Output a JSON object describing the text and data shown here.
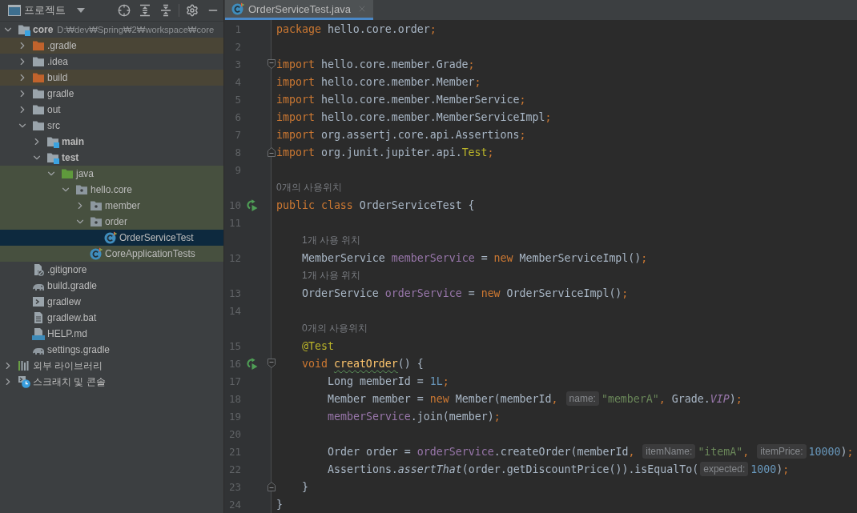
{
  "sidebar": {
    "title": "프로젝트",
    "tree": [
      {
        "label": "core",
        "hint": "D:₩dev₩Spring₩2₩workspace₩core",
        "kind": "module",
        "expanded": true,
        "selected": false,
        "children": [
          {
            "label": ".gradle",
            "kind": "excluded-folder",
            "color": "#4a4536",
            "expanded": false,
            "selected": false
          },
          {
            "label": ".idea",
            "kind": "folder",
            "expanded": false,
            "selected": false
          },
          {
            "label": "build",
            "kind": "excluded-folder",
            "color": "#4a4536",
            "expanded": false,
            "selected": false
          },
          {
            "label": "gradle",
            "kind": "folder",
            "expanded": false,
            "selected": false
          },
          {
            "label": "out",
            "kind": "folder",
            "expanded": false,
            "selected": false
          },
          {
            "label": "src",
            "kind": "folder",
            "expanded": true,
            "selected": false,
            "children": [
              {
                "label": "main",
                "kind": "module",
                "expanded": false,
                "selected": false
              },
              {
                "label": "test",
                "kind": "module",
                "expanded": true,
                "selected": false,
                "children": [
                  {
                    "label": "java",
                    "kind": "test-root",
                    "color": "#47503f",
                    "expanded": true,
                    "selected": false,
                    "children": [
                      {
                        "label": "hello.core",
                        "kind": "package",
                        "color": "#47503f",
                        "expanded": true,
                        "selected": false,
                        "children": [
                          {
                            "label": "member",
                            "kind": "package",
                            "color": "#47503f",
                            "expanded": false,
                            "selected": false
                          },
                          {
                            "label": "order",
                            "kind": "package",
                            "color": "#47503f",
                            "expanded": true,
                            "selected": false,
                            "children": [
                              {
                                "label": "OrderServiceTest",
                                "kind": "test-class",
                                "selected": true
                              }
                            ]
                          },
                          {
                            "label": "CoreApplicationTests",
                            "kind": "test-class",
                            "color": "#47503f",
                            "selected": false
                          }
                        ]
                      }
                    ]
                  }
                ]
              }
            ]
          },
          {
            "label": ".gitignore",
            "kind": "ignore-file",
            "selected": false
          },
          {
            "label": "build.gradle",
            "kind": "gradle-file",
            "selected": false
          },
          {
            "label": "gradlew",
            "kind": "shell-file",
            "selected": false
          },
          {
            "label": "gradlew.bat",
            "kind": "text-file",
            "selected": false
          },
          {
            "label": "HELP.md",
            "kind": "markdown-file",
            "selected": false
          },
          {
            "label": "settings.gradle",
            "kind": "gradle-file",
            "selected": false
          }
        ]
      },
      {
        "label": "외부 라이브러리",
        "kind": "libraries",
        "expanded": false,
        "selected": false
      },
      {
        "label": "스크래치 및 콘솔",
        "kind": "scratches",
        "expanded": false,
        "selected": false
      }
    ]
  },
  "editor": {
    "tabs": [
      {
        "label": "OrderServiceTest.java",
        "selected": true
      }
    ],
    "lines": [
      {
        "kind": "code",
        "number": "1",
        "tokens": [
          {
            "text": "package",
            "kind": "keyword"
          },
          {
            "text": " hello.core.order",
            "kind": "plain"
          },
          {
            "text": ";",
            "kind": "punct"
          }
        ]
      },
      {
        "kind": "code",
        "number": "2"
      },
      {
        "kind": "code",
        "number": "3",
        "markers": [
          {
            "kind": "fold-start"
          }
        ],
        "tokens": [
          {
            "text": "import",
            "kind": "keyword"
          },
          {
            "text": " hello.core.member.Grade",
            "kind": "plain"
          },
          {
            "text": ";",
            "kind": "punct"
          }
        ]
      },
      {
        "kind": "code",
        "number": "4",
        "tokens": [
          {
            "text": "import",
            "kind": "keyword"
          },
          {
            "text": " hello.core.member.Member",
            "kind": "plain"
          },
          {
            "text": ";",
            "kind": "punct"
          }
        ]
      },
      {
        "kind": "code",
        "number": "5",
        "tokens": [
          {
            "text": "import",
            "kind": "keyword"
          },
          {
            "text": " hello.core.member.MemberService",
            "kind": "plain"
          },
          {
            "text": ";",
            "kind": "punct"
          }
        ]
      },
      {
        "kind": "code",
        "number": "6",
        "tokens": [
          {
            "text": "import",
            "kind": "keyword"
          },
          {
            "text": " hello.core.member.MemberServiceImpl",
            "kind": "plain"
          },
          {
            "text": ";",
            "kind": "punct"
          }
        ]
      },
      {
        "kind": "code",
        "number": "7",
        "tokens": [
          {
            "text": "import",
            "kind": "keyword"
          },
          {
            "text": " org.assertj.core.api.Assertions",
            "kind": "plain"
          },
          {
            "text": ";",
            "kind": "punct"
          }
        ]
      },
      {
        "kind": "code",
        "number": "8",
        "markers": [
          {
            "kind": "fold-end"
          }
        ],
        "tokens": [
          {
            "text": "import",
            "kind": "keyword"
          },
          {
            "text": " org.junit.jupiter.api.",
            "kind": "plain"
          },
          {
            "text": "Test",
            "kind": "annotation"
          },
          {
            "text": ";",
            "kind": "punct"
          }
        ]
      },
      {
        "kind": "code",
        "number": "9"
      },
      {
        "kind": "usages",
        "tokens": [
          {
            "text": "0개의 사용위치",
            "kind": "usages"
          }
        ]
      },
      {
        "kind": "code",
        "number": "10",
        "markers": [
          {
            "kind": "run"
          }
        ],
        "tokens": [
          {
            "text": "public class",
            "kind": "keyword"
          },
          {
            "text": " OrderServiceTest {",
            "kind": "plain"
          }
        ],
        "children": [
          {
            "kind": "code",
            "number": "11"
          },
          {
            "kind": "usages",
            "tokens": [
              {
                "text": "1개 사용 위치",
                "kind": "usages"
              }
            ]
          },
          {
            "kind": "code",
            "number": "12",
            "tokens": [
              {
                "text": "MemberService ",
                "kind": "plain"
              },
              {
                "text": "memberService",
                "kind": "field"
              },
              {
                "text": " = ",
                "kind": "plain"
              },
              {
                "text": "new",
                "kind": "keyword"
              },
              {
                "text": " MemberServiceImpl()",
                "kind": "plain"
              },
              {
                "text": ";",
                "kind": "punct"
              }
            ]
          },
          {
            "kind": "usages",
            "tokens": [
              {
                "text": "1개 사용 위치",
                "kind": "usages"
              }
            ]
          },
          {
            "kind": "code",
            "number": "13",
            "tokens": [
              {
                "text": "OrderService ",
                "kind": "plain"
              },
              {
                "text": "orderService",
                "kind": "field"
              },
              {
                "text": " = ",
                "kind": "plain"
              },
              {
                "text": "new",
                "kind": "keyword"
              },
              {
                "text": " OrderServiceImpl()",
                "kind": "plain"
              },
              {
                "text": ";",
                "kind": "punct"
              }
            ]
          },
          {
            "kind": "code",
            "number": "14"
          },
          {
            "kind": "usages",
            "tokens": [
              {
                "text": "0개의 사용위치",
                "kind": "usages"
              }
            ]
          },
          {
            "kind": "code",
            "number": "15",
            "tokens": [
              {
                "text": "@Test",
                "kind": "annotation"
              }
            ]
          },
          {
            "kind": "code",
            "number": "16",
            "markers": [
              {
                "kind": "run"
              },
              {
                "kind": "fold-start"
              }
            ],
            "tokens": [
              {
                "text": "void ",
                "kind": "keyword"
              },
              {
                "text": "creatOrder",
                "kind": "misspelled"
              },
              {
                "text": "() {",
                "kind": "plain"
              }
            ],
            "children": [
              {
                "kind": "code",
                "number": "17",
                "tokens": [
                  {
                    "text": "Long memberId = ",
                    "kind": "plain"
                  },
                  {
                    "text": "1L",
                    "kind": "number"
                  },
                  {
                    "text": ";",
                    "kind": "punct"
                  }
                ]
              },
              {
                "kind": "code",
                "number": "18",
                "tokens": [
                  {
                    "text": "Member member = ",
                    "kind": "plain"
                  },
                  {
                    "text": "new",
                    "kind": "keyword"
                  },
                  {
                    "text": " Member(memberId",
                    "kind": "plain"
                  },
                  {
                    "text": ", ",
                    "kind": "punct"
                  },
                  {
                    "text": "name:",
                    "kind": "hint"
                  },
                  {
                    "text": "\"memberA\"",
                    "kind": "string"
                  },
                  {
                    "text": ",",
                    "kind": "punct"
                  },
                  {
                    "text": " Grade.",
                    "kind": "plain"
                  },
                  {
                    "text": "VIP",
                    "kind": "constant"
                  },
                  {
                    "text": ")",
                    "kind": "plain"
                  },
                  {
                    "text": ";",
                    "kind": "punct"
                  }
                ]
              },
              {
                "kind": "code",
                "number": "19",
                "tokens": [
                  {
                    "text": "memberService",
                    "kind": "field"
                  },
                  {
                    "text": ".join(member)",
                    "kind": "plain"
                  },
                  {
                    "text": ";",
                    "kind": "punct"
                  }
                ]
              },
              {
                "kind": "code",
                "number": "20"
              },
              {
                "kind": "code",
                "number": "21",
                "tokens": [
                  {
                    "text": "Order order = ",
                    "kind": "plain"
                  },
                  {
                    "text": "orderService",
                    "kind": "field"
                  },
                  {
                    "text": ".createOrder(memberId",
                    "kind": "plain"
                  },
                  {
                    "text": ", ",
                    "kind": "punct"
                  },
                  {
                    "text": "itemName:",
                    "kind": "hint"
                  },
                  {
                    "text": "\"itemA\"",
                    "kind": "string"
                  },
                  {
                    "text": ", ",
                    "kind": "punct"
                  },
                  {
                    "text": "itemPrice:",
                    "kind": "hint"
                  },
                  {
                    "text": "10000",
                    "kind": "number"
                  },
                  {
                    "text": ")",
                    "kind": "plain"
                  },
                  {
                    "text": ";",
                    "kind": "punct"
                  }
                ]
              },
              {
                "kind": "code",
                "number": "22",
                "tokens": [
                  {
                    "text": "Assertions.",
                    "kind": "plain"
                  },
                  {
                    "text": "assertThat",
                    "kind": "static-call"
                  },
                  {
                    "text": "(order.getDiscountPrice()).isEqualTo(",
                    "kind": "plain"
                  },
                  {
                    "text": "expected:",
                    "kind": "hint"
                  },
                  {
                    "text": "1000",
                    "kind": "number"
                  },
                  {
                    "text": ")",
                    "kind": "plain"
                  },
                  {
                    "text": ";",
                    "kind": "punct"
                  }
                ]
              }
            ]
          },
          {
            "kind": "code",
            "number": "23",
            "markers": [
              {
                "kind": "fold-end"
              }
            ],
            "tokens": [
              {
                "text": "}",
                "kind": "plain"
              }
            ]
          }
        ]
      },
      {
        "kind": "code",
        "number": "24",
        "tokens": [
          {
            "text": "}",
            "kind": "plain"
          }
        ]
      }
    ]
  }
}
